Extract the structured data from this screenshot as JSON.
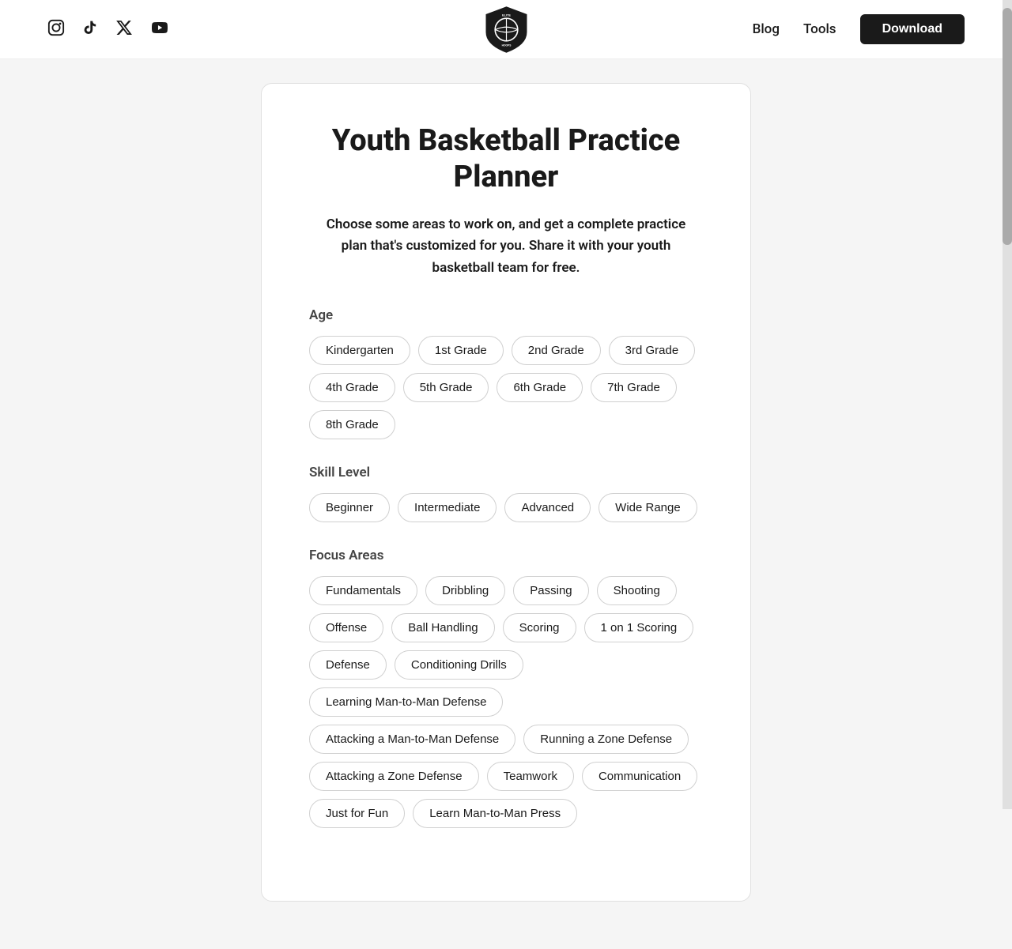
{
  "header": {
    "nav_links": [
      {
        "label": "Blog",
        "name": "blog-link"
      },
      {
        "label": "Tools",
        "name": "tools-link"
      }
    ],
    "download_label": "Download",
    "social_icons": [
      {
        "name": "instagram-icon",
        "symbol": "𝐈"
      },
      {
        "name": "tiktok-icon",
        "symbol": "♪"
      },
      {
        "name": "twitter-icon",
        "symbol": "𝕏"
      },
      {
        "name": "youtube-icon",
        "symbol": "▶"
      }
    ]
  },
  "page": {
    "title": "Youth Basketball Practice\nPlanner",
    "description": "Choose some areas to work on, and get a complete practice\nplan that's customized for you. Share it with your youth\nbasketball team for free."
  },
  "sections": {
    "age": {
      "label": "Age",
      "tags": [
        "Kindergarten",
        "1st Grade",
        "2nd Grade",
        "3rd Grade",
        "4th Grade",
        "5th Grade",
        "6th Grade",
        "7th Grade",
        "8th Grade"
      ]
    },
    "skill_level": {
      "label": "Skill Level",
      "tags": [
        "Beginner",
        "Intermediate",
        "Advanced",
        "Wide Range"
      ]
    },
    "focus_areas": {
      "label": "Focus Areas",
      "tags": [
        "Fundamentals",
        "Dribbling",
        "Passing",
        "Shooting",
        "Offense",
        "Ball Handling",
        "Scoring",
        "1 on 1 Scoring",
        "Defense",
        "Conditioning Drills",
        "Learning Man-to-Man Defense",
        "Attacking a Man-to-Man Defense",
        "Running a Zone Defense",
        "Attacking a Zone Defense",
        "Teamwork",
        "Communication",
        "Just for Fun",
        "Learn Man-to-Man Press"
      ]
    }
  }
}
